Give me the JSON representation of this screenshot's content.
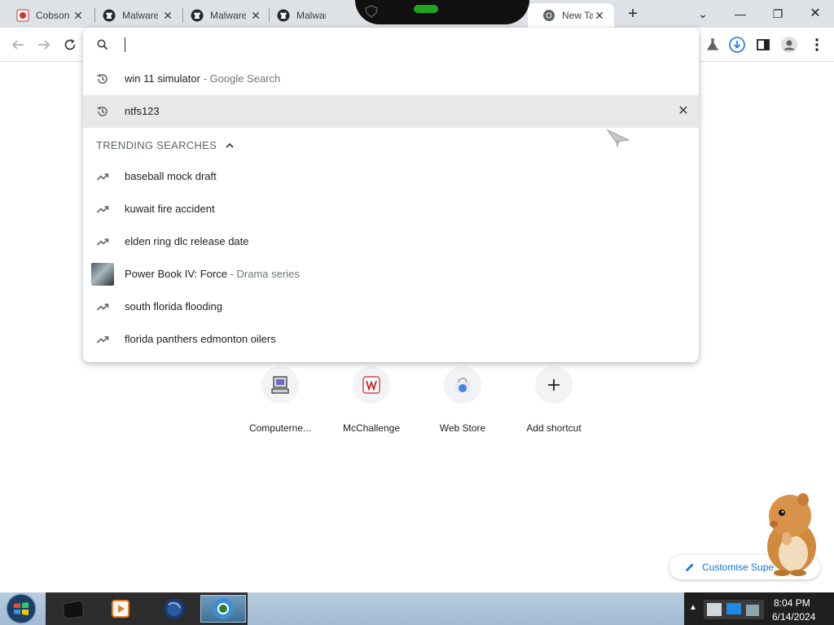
{
  "browser": {
    "tabs": [
      {
        "title": "Cobson",
        "icon": "cobson-favicon-icon"
      },
      {
        "title": "Malware",
        "icon": "github-icon"
      },
      {
        "title": "Malware",
        "icon": "github-icon"
      },
      {
        "title": "Malware",
        "icon": "github-icon"
      },
      {
        "title": "New Tab",
        "icon": "chrome-icon"
      }
    ],
    "new_tab_symbol": "+",
    "window_controls": {
      "dropdown": "⌄",
      "minimize": "—",
      "restore": "❐",
      "close": "✕"
    }
  },
  "omnibox": {
    "input_value": "",
    "history": [
      {
        "text": "win 11 simulator",
        "sub": " - Google Search",
        "icon": "history-icon"
      },
      {
        "text": "ntfs123",
        "sub": "",
        "icon": "history-icon"
      }
    ],
    "trending_header": "TRENDING SEARCHES",
    "trending": [
      {
        "text": "baseball mock draft",
        "sub": "",
        "icon": "trending-icon"
      },
      {
        "text": "kuwait fire accident",
        "sub": "",
        "icon": "trending-icon"
      },
      {
        "text": "elden ring dlc release date",
        "sub": "",
        "icon": "trending-icon"
      },
      {
        "text": "Power Book IV: Force",
        "sub": " - Drama series",
        "icon": "thumbnail-image"
      },
      {
        "text": "south florida flooding",
        "sub": "",
        "icon": "trending-icon"
      },
      {
        "text": "florida panthers edmonton oilers",
        "sub": "",
        "icon": "trending-icon"
      }
    ]
  },
  "shortcuts": [
    {
      "label": "Computerne...",
      "icon": "computer-icon"
    },
    {
      "label": "McChallenge",
      "icon": "mcchallenge-icon"
    },
    {
      "label": "Web Store",
      "icon": "web-store-icon"
    },
    {
      "label": "Add shortcut",
      "icon": "plus-icon"
    }
  ],
  "customise_label": "Customise Supe",
  "taskbar": {
    "clock_time": "8:04 PM",
    "clock_date": "6/14/2024"
  },
  "colors": {
    "accent_blue": "#1a73e8",
    "tabstrip_bg": "#dee1e6",
    "taskbar_bg": "#a2bad3"
  }
}
